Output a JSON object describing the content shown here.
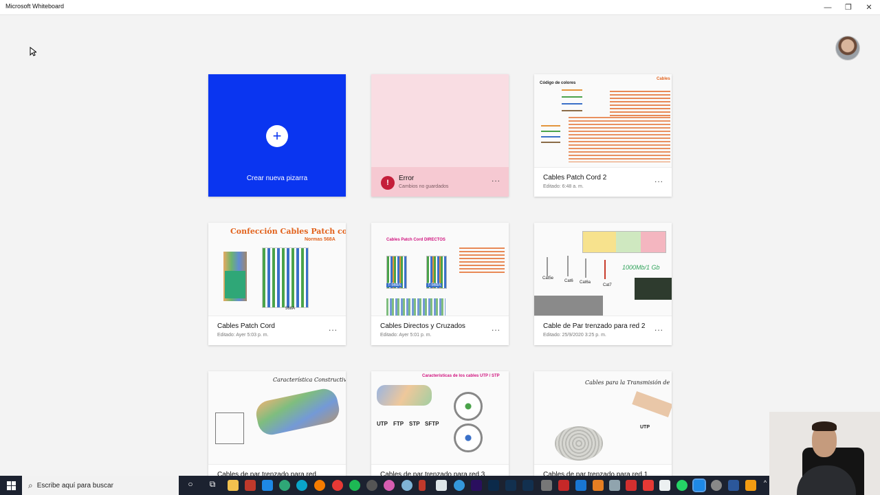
{
  "window": {
    "title": "Microsoft Whiteboard",
    "controls": {
      "minimize": "—",
      "restore": "❐",
      "close": "✕"
    }
  },
  "create_card": {
    "label": "Crear nueva pizarra",
    "icon": "plus-icon"
  },
  "error_card": {
    "title": "Error",
    "subtitle": "Cambios no guardados",
    "icon": "warning-icon"
  },
  "more_label": "...",
  "boards": [
    {
      "title": "Cables Patch Cord 2",
      "edited": "Editado: 6:48 a. m."
    },
    {
      "title": "Cables Patch Cord",
      "edited": "Editado: Ayer 5:03 p. m."
    },
    {
      "title": "Cables Directos y Cruzados",
      "edited": "Editado: Ayer 5:01 p. m."
    },
    {
      "title": "Cable de Par trenzado para red 2",
      "edited": "Editado: 25/9/2020 3:25 p. m."
    },
    {
      "title": "Cables de par trenzado para red",
      "edited": ""
    },
    {
      "title": "Cables de par trenzado para red 3",
      "edited": ""
    },
    {
      "title": "Cables de par trenzado para red 1",
      "edited": ""
    }
  ],
  "thumb_text": {
    "b1_heading": "Código de colores",
    "b1_corner": "Cables",
    "b2_heading": "Confección Cables Patch cord",
    "b2_sub": "Normas 568A",
    "b2_tag": "568A",
    "b3_heading": "Cables Patch Cord DIRECTOS",
    "b3_tag_a": "T-568A",
    "b3_tag_b": "T-568A",
    "b4_speed": "1000Mb/1 Gb",
    "b4_cats": [
      "Cat5e",
      "Cat6",
      "Cat6a",
      "Cat7"
    ],
    "b5_heading": "Característica Constructiva",
    "b6_heading": "Características de los cables UTP / STP",
    "b6_types": [
      "UTP",
      "FTP",
      "STP",
      "SFTP"
    ],
    "b7_heading": "Cables para la Transmisión de",
    "b7_tag": "UTP"
  },
  "taskbar": {
    "search_placeholder": "Escribe aquí para buscar",
    "apps": [
      "cortana-icon",
      "task-view-icon",
      "file-explorer-icon",
      "filezilla-icon",
      "store-icon",
      "edge-icon",
      "firefox-icon",
      "chrome-icon",
      "spotify-icon",
      "settings-icon",
      "itunes-icon",
      "maps-icon",
      "phone-icon",
      "edge-dev-icon",
      "steam-icon",
      "premiere-icon",
      "photoshop-icon",
      "lightroom-icon",
      "lightroom-classic-icon",
      "calculator-icon",
      "netflix-icon",
      "outlook-icon",
      "photos-icon",
      "3d-viewer-icon",
      "acrobat-icon",
      "gmail-icon",
      "notepad-icon",
      "whatsapp-icon",
      "whiteboard-icon",
      "clock-icon",
      "word-icon",
      "paint-icon"
    ]
  },
  "colors": {
    "accent": "#0a35f0",
    "error_bg": "#f9dde3",
    "error_icon": "#c41e3a",
    "taskbar": "#1c2230",
    "orange_text": "#e2621c"
  }
}
